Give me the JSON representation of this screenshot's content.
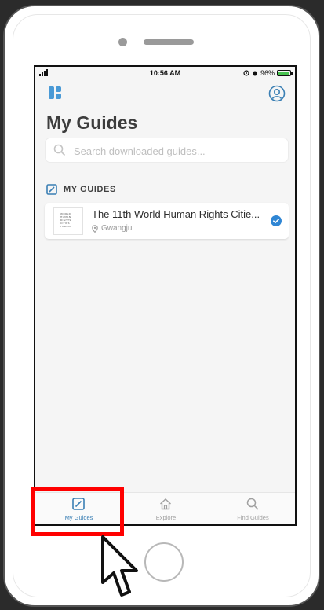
{
  "status_bar": {
    "time": "10:56 AM",
    "battery": "96%",
    "battery_level": 0.96
  },
  "header": {
    "title": "My Guides",
    "logo_icon": "app-logo-icon",
    "profile_icon": "user-circle-icon"
  },
  "search": {
    "placeholder": "Search downloaded guides..."
  },
  "section": {
    "title": "MY GUIDES",
    "icon": "guide-book-icon"
  },
  "guides": [
    {
      "title": "The 11th World Human Rights Citie...",
      "location": "Gwangju",
      "thumbnail_text": "WORLD HUMAN RIGHTS CITIES FORUM",
      "downloaded": true
    }
  ],
  "tabs": [
    {
      "label": "My Guides",
      "icon": "guide-book-icon",
      "active": true
    },
    {
      "label": "Explore",
      "icon": "home-icon",
      "active": false
    },
    {
      "label": "Find Guides",
      "icon": "search-icon",
      "active": false
    }
  ],
  "colors": {
    "accent": "#3a7fb4",
    "highlight": "#ff0000",
    "check": "#2f86d4",
    "background": "#f5f5f5"
  }
}
